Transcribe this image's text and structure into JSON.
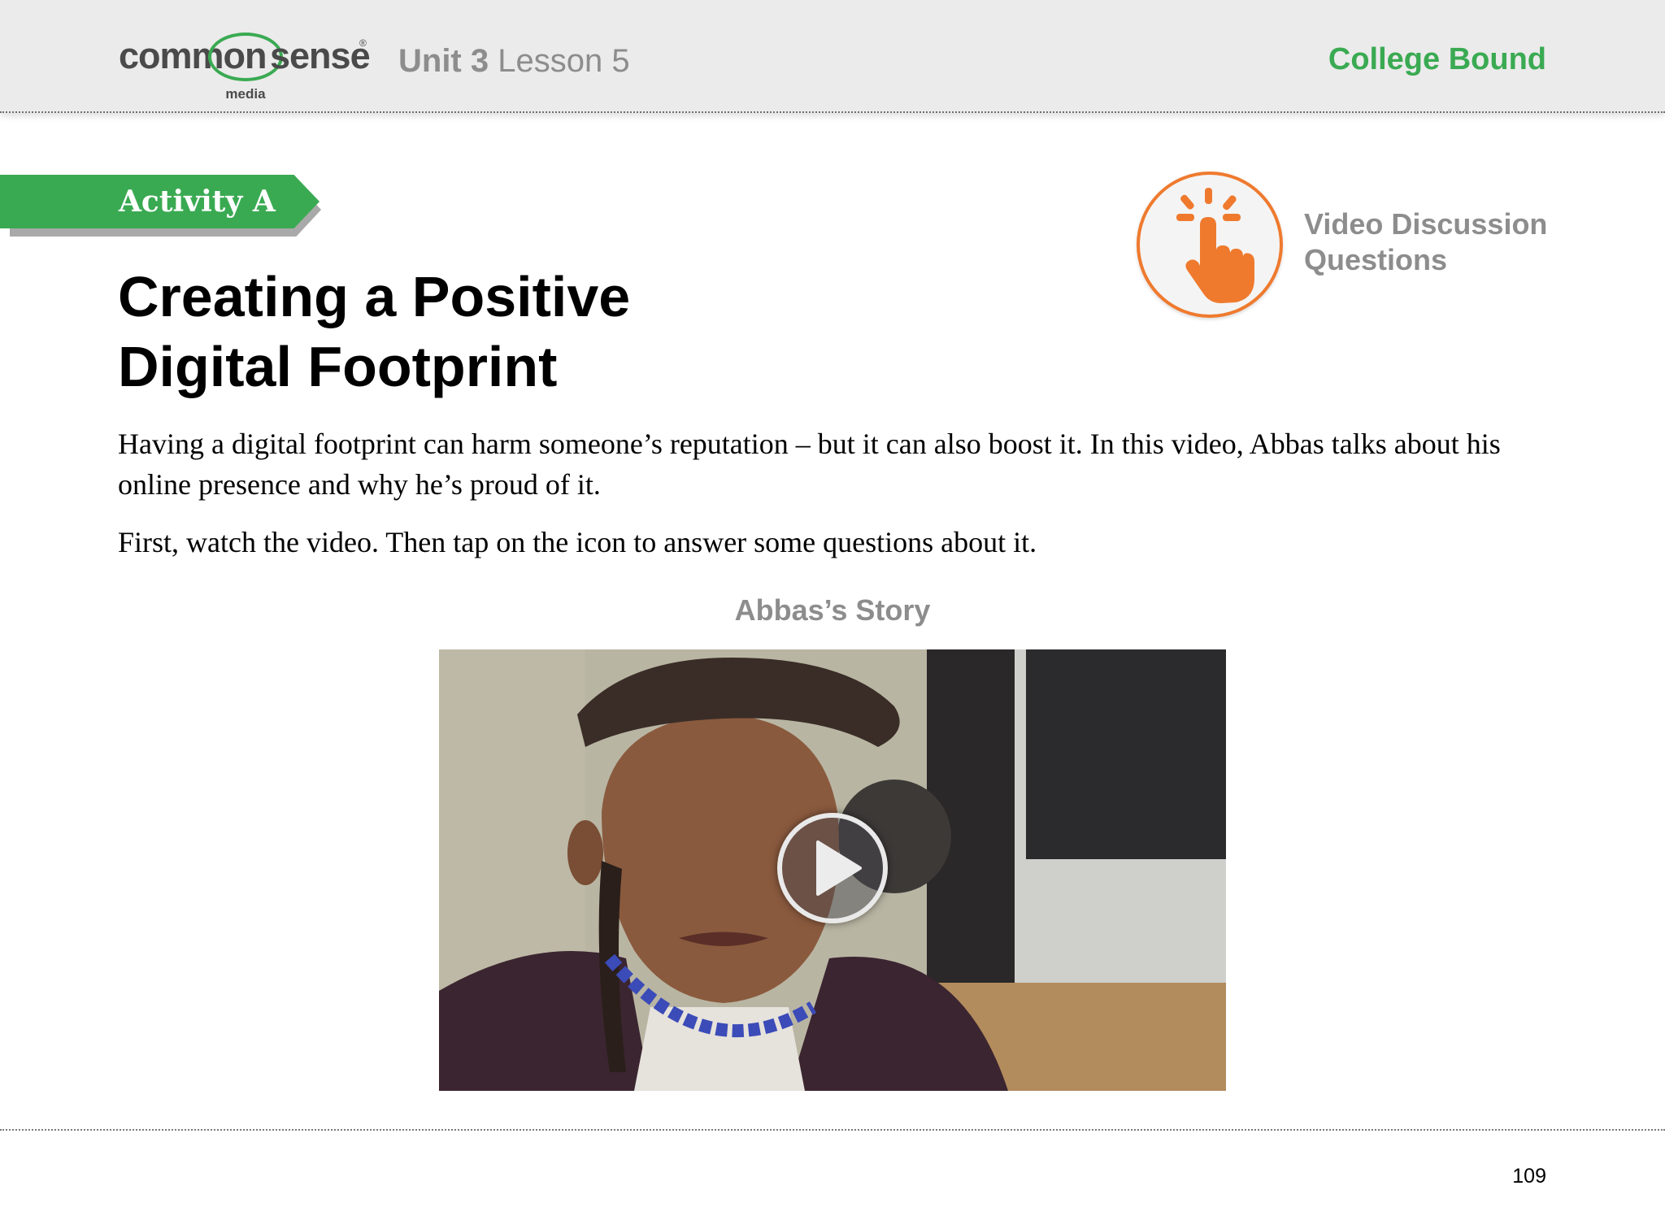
{
  "header": {
    "logo": {
      "common": "common",
      "sense": "sense",
      "reg": "®",
      "media": "media"
    },
    "unit": "Unit 3",
    "lesson": "Lesson 5",
    "course": "College Bound"
  },
  "activity": {
    "label": "Activity A"
  },
  "title": {
    "line1": "Creating a Positive",
    "line2": "Digital Footprint"
  },
  "discussion": {
    "icon": "tap-finger-icon",
    "line1": "Video Discussion",
    "line2": "Questions"
  },
  "paragraphs": [
    "Having a digital footprint can harm someone’s reputation – but it can also boost it. In this video, Abbas talks about his online presence and why he’s proud of it.",
    "First, watch the video. Then tap on the icon to answer some questions about it."
  ],
  "video": {
    "title": "Abbas’s Story",
    "play_icon": "play-icon"
  },
  "footer": {
    "page_number": "109"
  },
  "colors": {
    "brand_green": "#3aaa52",
    "accent_orange": "#ef7a2e",
    "muted_gray": "#8d8d8d",
    "header_bg": "#ebebeb"
  }
}
